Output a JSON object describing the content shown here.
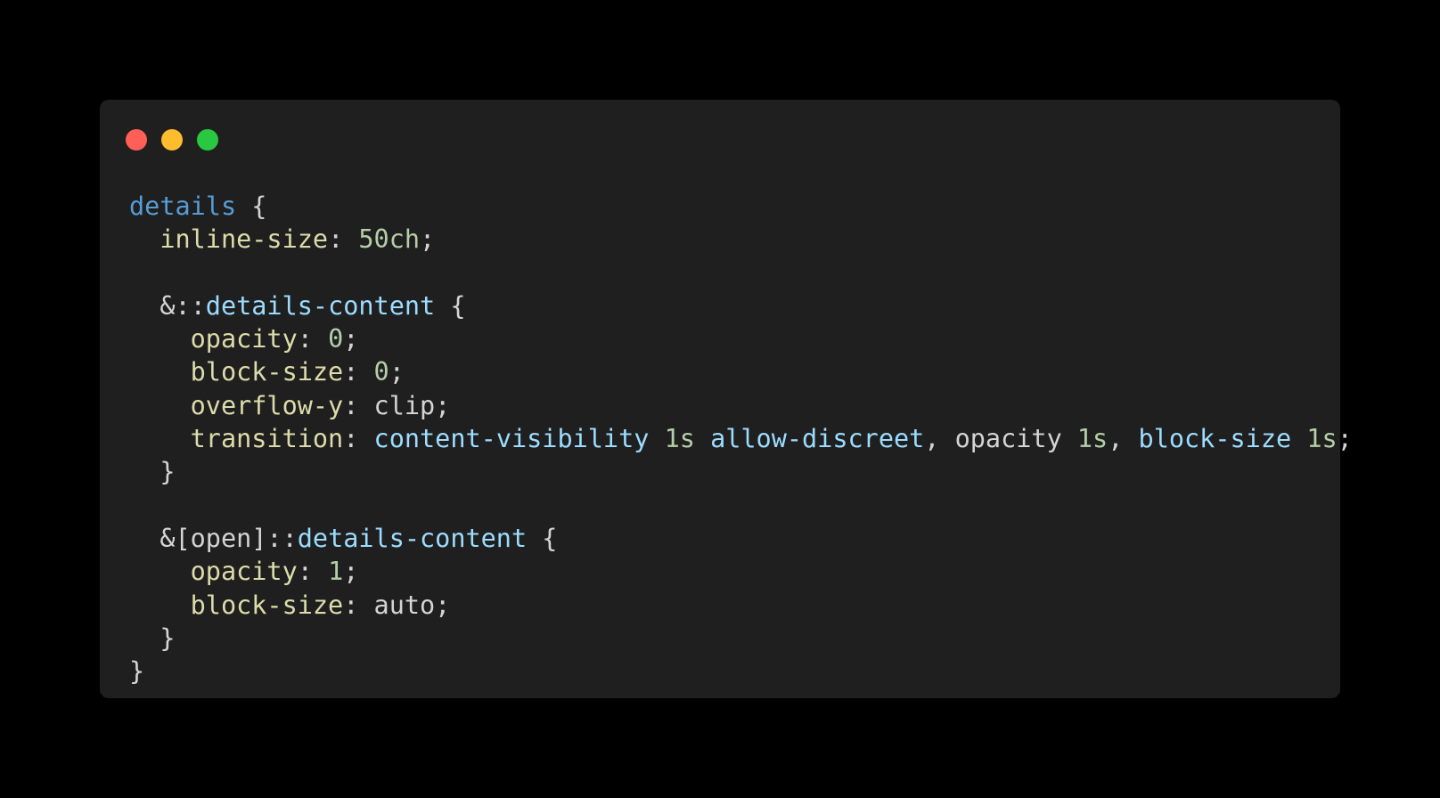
{
  "window_controls": {
    "close_color": "#ff5f57",
    "minimize_color": "#febc2e",
    "zoom_color": "#28c840"
  },
  "colors": {
    "selector": "#569cd6",
    "property": "#dcdcaa",
    "number": "#b5cea8",
    "keyword": "#9cdcfe",
    "plain": "#d4d4d4"
  },
  "code_lines": [
    [
      {
        "t": "details",
        "c": "selector"
      },
      {
        "t": " {",
        "c": "plain"
      }
    ],
    [
      {
        "t": "  inline-size",
        "c": "property"
      },
      {
        "t": ": ",
        "c": "plain"
      },
      {
        "t": "50ch",
        "c": "number"
      },
      {
        "t": ";",
        "c": "plain"
      }
    ],
    [],
    [
      {
        "t": "  &::",
        "c": "plain"
      },
      {
        "t": "details-content",
        "c": "keyword"
      },
      {
        "t": " {",
        "c": "plain"
      }
    ],
    [
      {
        "t": "    opacity",
        "c": "property"
      },
      {
        "t": ": ",
        "c": "plain"
      },
      {
        "t": "0",
        "c": "number"
      },
      {
        "t": ";",
        "c": "plain"
      }
    ],
    [
      {
        "t": "    block-size",
        "c": "property"
      },
      {
        "t": ": ",
        "c": "plain"
      },
      {
        "t": "0",
        "c": "number"
      },
      {
        "t": ";",
        "c": "plain"
      }
    ],
    [
      {
        "t": "    overflow-y",
        "c": "property"
      },
      {
        "t": ": clip;",
        "c": "plain"
      }
    ],
    [
      {
        "t": "    transition",
        "c": "property"
      },
      {
        "t": ": ",
        "c": "plain"
      },
      {
        "t": "content-visibility",
        "c": "keyword"
      },
      {
        "t": " ",
        "c": "plain"
      },
      {
        "t": "1s",
        "c": "number"
      },
      {
        "t": " ",
        "c": "plain"
      },
      {
        "t": "allow-discreet",
        "c": "keyword"
      },
      {
        "t": ", opacity ",
        "c": "plain"
      },
      {
        "t": "1s",
        "c": "number"
      },
      {
        "t": ", ",
        "c": "plain"
      },
      {
        "t": "block-size",
        "c": "keyword"
      },
      {
        "t": " ",
        "c": "plain"
      },
      {
        "t": "1s",
        "c": "number"
      },
      {
        "t": ";",
        "c": "plain"
      }
    ],
    [
      {
        "t": "  }",
        "c": "plain"
      }
    ],
    [],
    [
      {
        "t": "  &[open]::",
        "c": "plain"
      },
      {
        "t": "details-content",
        "c": "keyword"
      },
      {
        "t": " {",
        "c": "plain"
      }
    ],
    [
      {
        "t": "    opacity",
        "c": "property"
      },
      {
        "t": ": ",
        "c": "plain"
      },
      {
        "t": "1",
        "c": "number"
      },
      {
        "t": ";",
        "c": "plain"
      }
    ],
    [
      {
        "t": "    block-size",
        "c": "property"
      },
      {
        "t": ": auto;",
        "c": "plain"
      }
    ],
    [
      {
        "t": "  }",
        "c": "plain"
      }
    ],
    [
      {
        "t": "}",
        "c": "plain"
      }
    ]
  ]
}
